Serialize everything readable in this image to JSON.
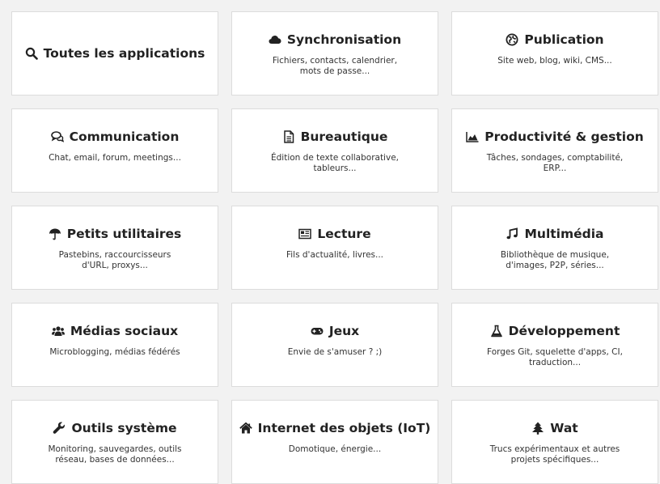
{
  "categories": [
    {
      "title": "Toutes les applications",
      "desc": "",
      "icon": "search-icon"
    },
    {
      "title": "Synchronisation",
      "desc": "Fichiers, contacts, calendrier, mots de passe...",
      "icon": "cloud-icon"
    },
    {
      "title": "Publication",
      "desc": "Site web, blog, wiki, CMS...",
      "icon": "globe-icon"
    },
    {
      "title": "Communication",
      "desc": "Chat, email, forum, meetings...",
      "icon": "chat-icon"
    },
    {
      "title": "Bureautique",
      "desc": "Édition de texte collaborative, tableurs...",
      "icon": "document-icon"
    },
    {
      "title": "Productivité & gestion",
      "desc": "Tâches, sondages, comptabilité, ERP...",
      "icon": "area-chart-icon"
    },
    {
      "title": "Petits utilitaires",
      "desc": "Pastebins, raccourcisseurs d'URL, proxys...",
      "icon": "umbrella-icon"
    },
    {
      "title": "Lecture",
      "desc": "Fils d'actualité, livres...",
      "icon": "newspaper-icon"
    },
    {
      "title": "Multimédia",
      "desc": "Bibliothèque de musique, d'images, P2P, séries...",
      "icon": "music-icon"
    },
    {
      "title": "Médias sociaux",
      "desc": "Microblogging, médias fédérés",
      "icon": "users-icon"
    },
    {
      "title": "Jeux",
      "desc": "Envie de s'amuser ? ;)",
      "icon": "gamepad-icon"
    },
    {
      "title": "Développement",
      "desc": "Forges Git, squelette d'apps, CI, traduction...",
      "icon": "flask-icon"
    },
    {
      "title": "Outils système",
      "desc": "Monitoring, sauvegardes, outils réseau, bases de données...",
      "icon": "wrench-icon"
    },
    {
      "title": "Internet des objets (IoT)",
      "desc": "Domotique, énergie...",
      "icon": "home-icon"
    },
    {
      "title": "Wat",
      "desc": "Trucs expérimentaux et autres projets spécifiques...",
      "icon": "tree-icon"
    }
  ]
}
